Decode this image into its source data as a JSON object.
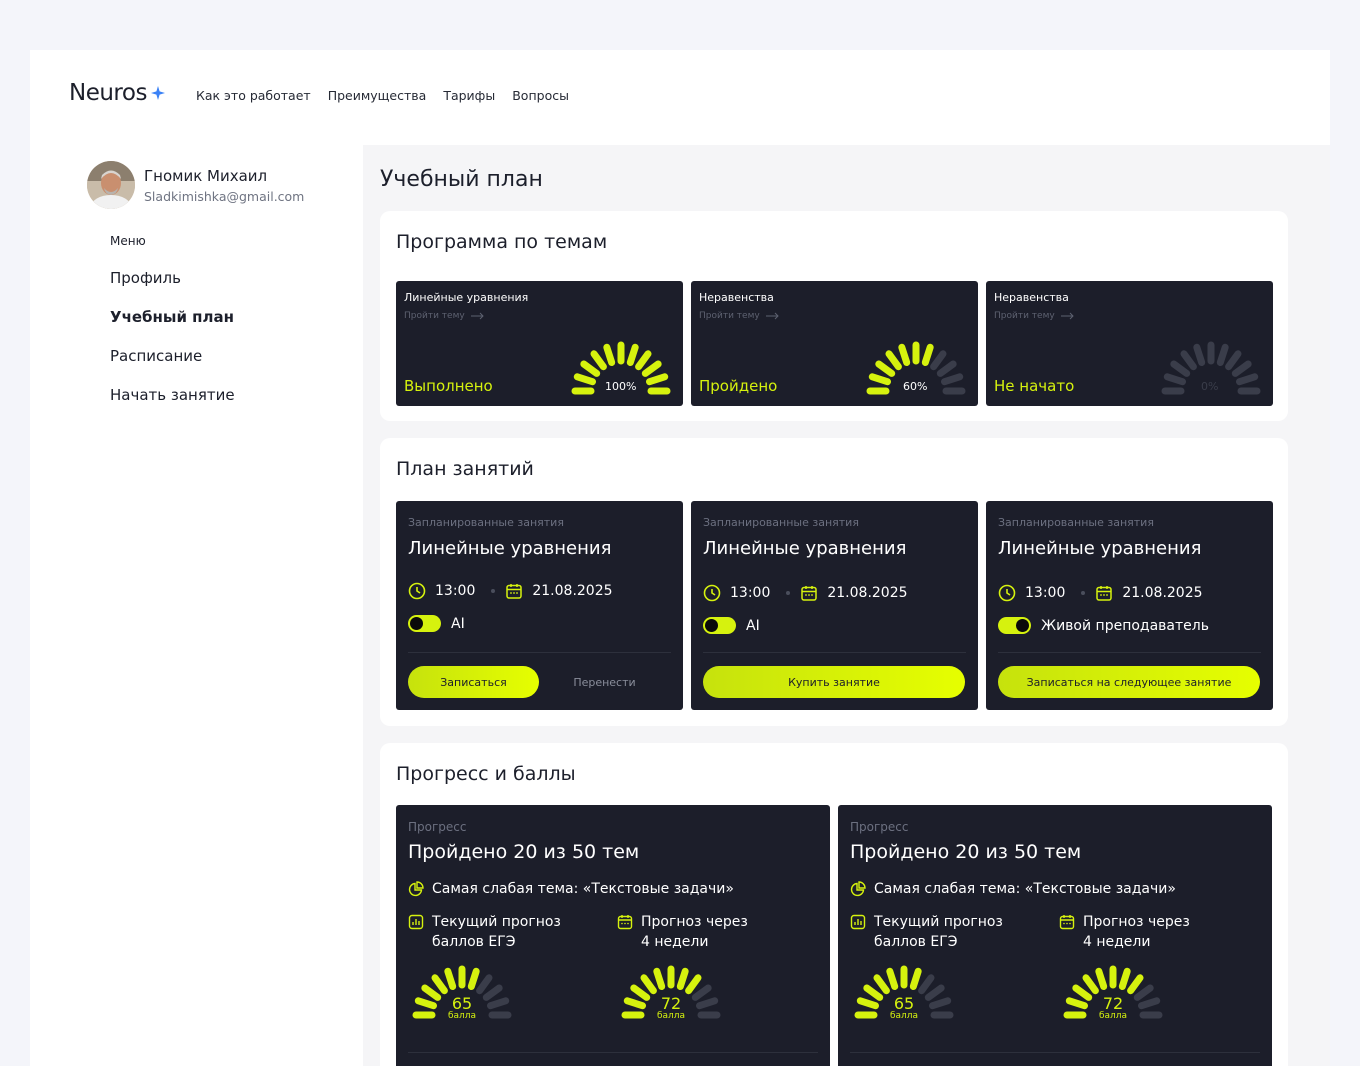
{
  "brand": {
    "name": "Neuros",
    "accent": "#3b82f6"
  },
  "nav": [
    "Как это работает",
    "Преимущества",
    "Тарифы",
    "Вопросы"
  ],
  "user": {
    "name": "Гномик Михаил",
    "email": "Sladkimishka@gmail.com"
  },
  "menu": {
    "caption": "Меню",
    "items": [
      "Профиль",
      "Учебный план",
      "Расписание",
      "Начать занятие"
    ],
    "active_index": 1
  },
  "page_title": "Учебный план",
  "colors": {
    "card_bg": "#1c1e2a",
    "lime": "#d6f20e",
    "muted": "#3a3d4a"
  },
  "topics": {
    "title": "Программа по темам",
    "cards": [
      {
        "title": "Линейные уравнения",
        "link": "Пройти тему",
        "status": "Выполнено",
        "percent_label": "100%",
        "progress": 1.0
      },
      {
        "title": "Неравенства",
        "link": "Пройти тему",
        "status": "Пройдено",
        "percent_label": "60%",
        "progress": 0.6
      },
      {
        "title": "Неравенства",
        "link": "Пройти тему",
        "status": "Не начато",
        "percent_label": "0%",
        "progress": 0.0
      }
    ]
  },
  "lessons": {
    "title": "План занятий",
    "cards": [
      {
        "caption": "Запланированные занятия",
        "title": "Линейные уравнения",
        "time": "13:00",
        "date": "21.08.2025",
        "mode": "AI",
        "toggle_on": false,
        "primary": "Записаться",
        "secondary": "Перенести"
      },
      {
        "caption": "Запланированные занятия",
        "title": "Линейные уравнения",
        "time": "13:00",
        "date": "21.08.2025",
        "mode": "AI",
        "toggle_on": false,
        "primary": "Купить занятие",
        "secondary": ""
      },
      {
        "caption": "Запланированные занятия",
        "title": "Линейные уравнения",
        "time": "13:00",
        "date": "21.08.2025",
        "mode": "Живой преподаватель",
        "toggle_on": true,
        "primary": "Записаться на следующее занятие",
        "secondary": ""
      }
    ]
  },
  "progress": {
    "title": "Прогресс и баллы",
    "cards": [
      {
        "caption": "Прогресс",
        "title": "Пройдено 20 из 50 тем",
        "weak_topic": "Самая слабая тема: «Текстовые задачи»",
        "current_label": [
          "Текущий прогноз",
          "баллов ЕГЭ"
        ],
        "future_label": [
          "Прогноз через",
          "4 недели"
        ],
        "current_score": "65",
        "current_unit": "балла",
        "current_progress": 0.65,
        "future_score": "72",
        "future_unit": "балла",
        "future_progress": 0.72
      },
      {
        "caption": "Прогресс",
        "title": "Пройдено 20 из 50 тем",
        "weak_topic": "Самая слабая тема: «Текстовые задачи»",
        "current_label": [
          "Текущий прогноз",
          "баллов ЕГЭ"
        ],
        "future_label": [
          "Прогноз через",
          "4 недели"
        ],
        "current_score": "65",
        "current_unit": "балла",
        "current_progress": 0.65,
        "future_score": "72",
        "future_unit": "балла",
        "future_progress": 0.72
      }
    ]
  }
}
